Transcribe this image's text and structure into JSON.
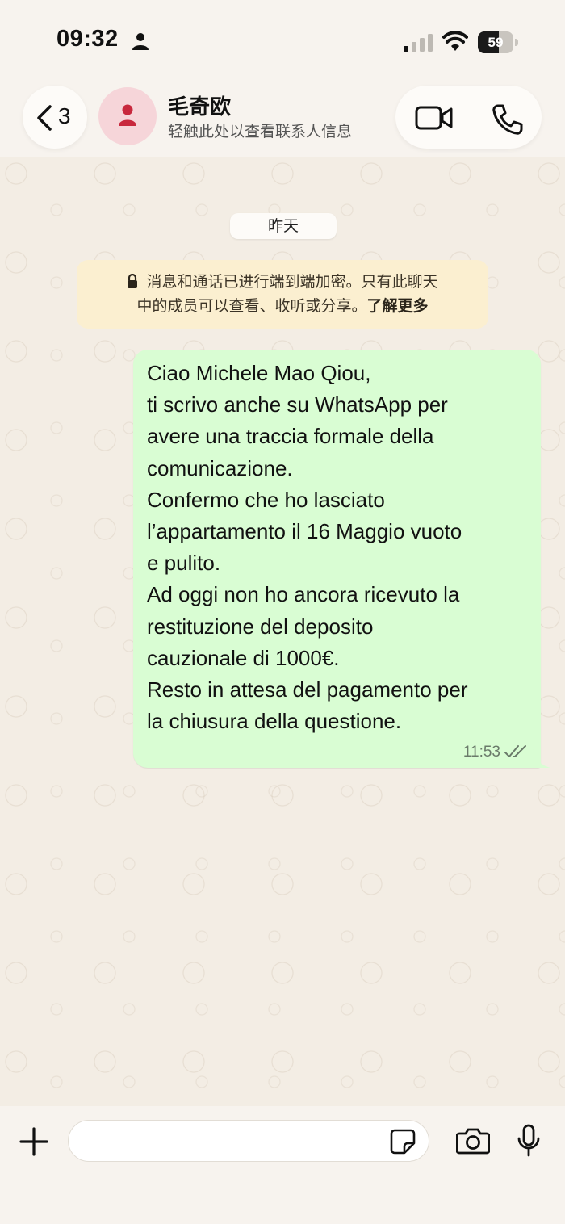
{
  "status_bar": {
    "time": "09:32",
    "battery_level": "59",
    "icons": [
      "person-icon",
      "cellular-signal-icon",
      "wifi-icon",
      "battery-icon"
    ]
  },
  "header": {
    "back_count": "3",
    "contact_name": "毛奇欧",
    "contact_subtitle": "轻触此处以查看联系人信息",
    "icons": [
      "back-chevron-icon",
      "avatar-person-icon",
      "video-call-icon",
      "voice-call-icon"
    ]
  },
  "chat": {
    "date_label": "昨天",
    "encryption_notice": {
      "line1": "消息和通话已进行端到端加密。只有此聊天",
      "line2": "中的成员可以查看、收听或分享。",
      "learn_more": "了解更多"
    },
    "messages": [
      {
        "direction": "outgoing",
        "lines": [
          "Ciao Michele Mao Qiou,",
          "ti scrivo anche su WhatsApp per",
          "avere una traccia formale della",
          "comunicazione.",
          "Confermo che ho lasciato",
          "l’appartamento il 16 Maggio vuoto",
          "e pulito.",
          "Ad oggi non ho ancora ricevuto la",
          "restituzione del deposito",
          "cauzionale di 1000€.",
          "Resto in attesa del pagamento per",
          "la chiusura della questione."
        ],
        "time": "11:53",
        "status": "read"
      }
    ]
  },
  "composer": {
    "input_value": "",
    "icons": [
      "plus-icon",
      "sticker-icon",
      "camera-icon",
      "microphone-icon"
    ]
  },
  "colors": {
    "outgoing_bubble": "#d9fdd3",
    "notice_background": "#fbefd0",
    "avatar_background": "#f6d5d9",
    "avatar_icon": "#c8283d",
    "read_ticks": "#6a7a6a"
  }
}
